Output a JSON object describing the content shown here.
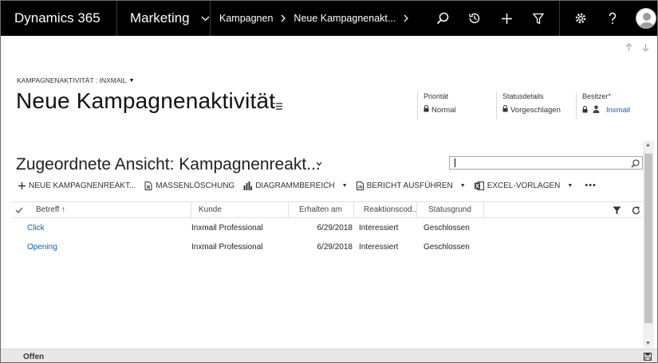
{
  "nav": {
    "brand": "Dynamics 365",
    "module": "Marketing",
    "breadcrumbs": [
      "Kampagnen",
      "Neue Kampagnenakt..."
    ]
  },
  "form": {
    "entity_selector": "KAMPAGNENAKTIVITÄT : INXMAIL",
    "title": "Neue Kampagnenaktivität",
    "header_fields": [
      {
        "label": "Priorität",
        "value": "Normal"
      },
      {
        "label": "Statusdetails",
        "value": "Vorgeschlagen"
      },
      {
        "label": "Besitzer",
        "required_mark": "*",
        "value": "Inxmail"
      }
    ]
  },
  "subgrid": {
    "title": "Zugeordnete Ansicht: Kampagnenreakt...",
    "search_placeholder": "",
    "commands": [
      {
        "label": "NEUE KAMPAGNENREAKT...",
        "icon": "plus-icon"
      },
      {
        "label": "MASSENLÖSCHUNG",
        "icon": "bulk-delete-icon"
      },
      {
        "label": "DIAGRAMMBEREICH",
        "icon": "chart-icon"
      },
      {
        "label": "BERICHT AUSFÜHREN",
        "icon": "report-icon"
      },
      {
        "label": "EXCEL-VORLAGEN",
        "icon": "excel-icon"
      }
    ],
    "more_label": "•••",
    "columns": [
      "Betreff ↑",
      "Kunde",
      "Erhalten am",
      "Reaktionscod...",
      "Statusgrund"
    ],
    "rows": [
      {
        "betreff": "Click",
        "kunde": "Inxmail Professional",
        "erhalten": "6/29/2018",
        "reaktion": "Interessiert",
        "status": "Geschlossen"
      },
      {
        "betreff": "Opening",
        "kunde": "Inxmail Professional",
        "erhalten": "6/29/2018",
        "reaktion": "Interessiert",
        "status": "Geschlossen"
      }
    ]
  },
  "footer": {
    "status": "Offen"
  }
}
